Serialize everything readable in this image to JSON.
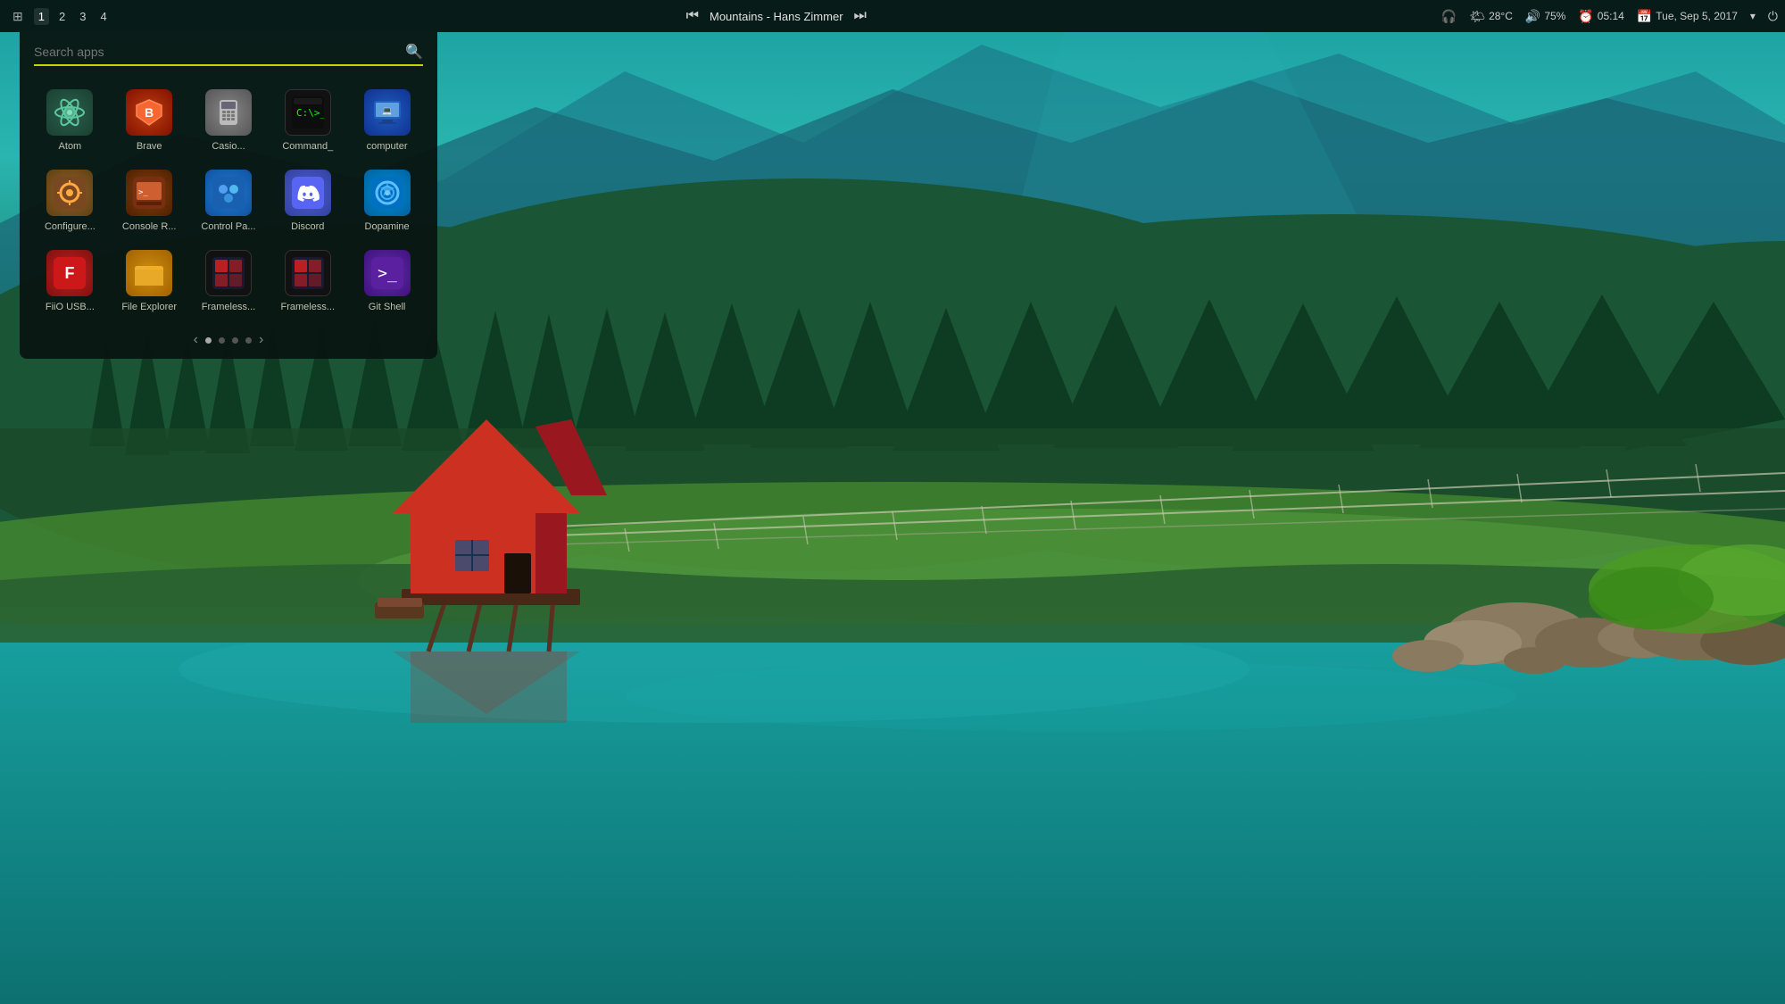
{
  "taskbar": {
    "grid_icon": "⊞",
    "workspaces": [
      "1",
      "2",
      "3",
      "4"
    ],
    "active_workspace": "1",
    "media": {
      "prev_label": "⏮",
      "next_label": "⏭",
      "track": "Mountains - Hans Zimmer"
    },
    "tray": {
      "headset_icon": "🎧",
      "weather_icon": "🌤",
      "temp": "28°C",
      "volume_icon": "🔊",
      "volume": "75%",
      "clock_icon": "⏰",
      "time": "05:14",
      "calendar_icon": "📅",
      "date": "Tue, Sep 5, 2017",
      "dropdown_icon": "▾",
      "power_icon": "⏻"
    }
  },
  "launcher": {
    "search_placeholder": "Search apps",
    "apps": [
      {
        "id": "atom",
        "label": "Atom",
        "icon_class": "icon-atom",
        "icon": "⚛"
      },
      {
        "id": "brave",
        "label": "Brave",
        "icon_class": "icon-brave",
        "icon": "🦁"
      },
      {
        "id": "casio",
        "label": "Casio...",
        "icon_class": "icon-casio",
        "icon": "📱"
      },
      {
        "id": "command",
        "label": "Command_",
        "icon_class": "icon-command",
        "icon": "▶_"
      },
      {
        "id": "computer",
        "label": "computer",
        "icon_class": "icon-computer",
        "icon": "💻"
      },
      {
        "id": "configure",
        "label": "Configure...",
        "icon_class": "icon-configure",
        "icon": "⚙"
      },
      {
        "id": "console",
        "label": "Console R...",
        "icon_class": "icon-console",
        "icon": "📟"
      },
      {
        "id": "controlpanel",
        "label": "Control Pa...",
        "icon_class": "icon-controlpanel",
        "icon": "🖥"
      },
      {
        "id": "discord",
        "label": "Discord",
        "icon_class": "icon-discord",
        "icon": "💬"
      },
      {
        "id": "dopamine",
        "label": "Dopamine",
        "icon_class": "icon-dopamine",
        "icon": "🎵"
      },
      {
        "id": "fiio",
        "label": "FiiO USB...",
        "icon_class": "icon-fiio",
        "icon": "F"
      },
      {
        "id": "fileexplorer",
        "label": "File Explorer",
        "icon_class": "icon-fileexplorer",
        "icon": "📁"
      },
      {
        "id": "frameless1",
        "label": "Frameless...",
        "icon_class": "icon-frameless1",
        "icon": "🖼"
      },
      {
        "id": "frameless2",
        "label": "Frameless...",
        "icon_class": "icon-frameless2",
        "icon": "🖼"
      },
      {
        "id": "gitshell",
        "label": "Git Shell",
        "icon_class": "icon-gitshell",
        "icon": ">"
      }
    ],
    "pagination": {
      "prev": "‹",
      "next": "›",
      "dots": [
        {
          "active": true
        },
        {
          "active": false
        },
        {
          "active": false
        },
        {
          "active": false
        }
      ]
    }
  }
}
